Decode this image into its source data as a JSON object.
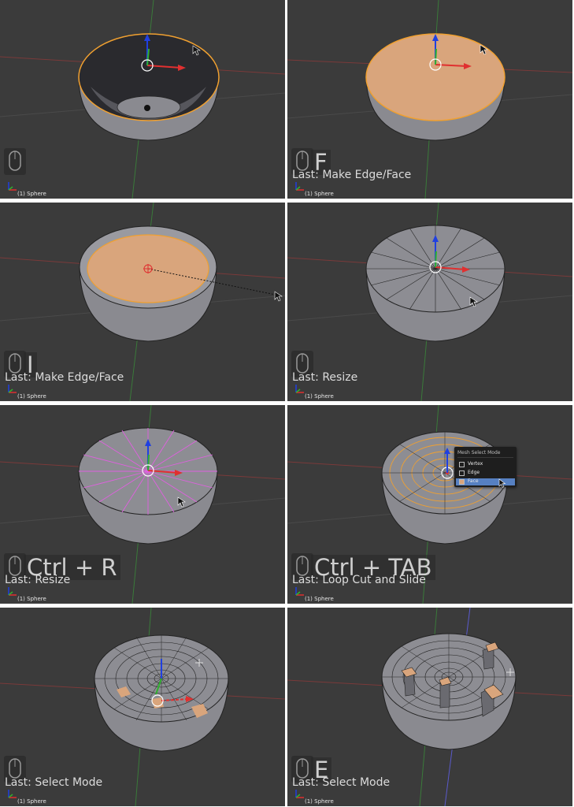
{
  "panels": [
    {
      "id": "p1",
      "key": "",
      "last_op": "",
      "object_name": "(1) Sphere"
    },
    {
      "id": "p2",
      "key": "F",
      "last_op": "Last: Make Edge/Face",
      "object_name": "(1) Sphere"
    },
    {
      "id": "p3",
      "key": "I",
      "last_op": "Last: Make Edge/Face",
      "object_name": "(1) Sphere"
    },
    {
      "id": "p4",
      "key": "",
      "last_op": "Last: Resize",
      "object_name": "(1) Sphere"
    },
    {
      "id": "p5",
      "key": "Ctrl + R",
      "last_op": "Last: Resize",
      "object_name": "(1) Sphere"
    },
    {
      "id": "p6",
      "key": "Ctrl + TAB",
      "last_op": "Last: Loop Cut and Slide",
      "object_name": "(1) Sphere"
    },
    {
      "id": "p7",
      "key": "",
      "last_op": "Last: Select Mode",
      "object_name": "(1) Sphere"
    },
    {
      "id": "p8",
      "key": "E",
      "last_op": "Last: Select Mode",
      "object_name": "(1) Sphere"
    }
  ],
  "select_mode_menu": {
    "title": "Mesh Select Mode",
    "items": [
      "Vertex",
      "Edge",
      "Face"
    ],
    "active": "Face"
  },
  "colors": {
    "viewport_bg": "#3b3b3b",
    "mesh_face": "#8d8d93",
    "selected_face": "#d9a57c",
    "selected_edge": "#f0a030",
    "loop_cut": "#e060e0",
    "axis_x": "#e03030",
    "axis_y": "#30b030",
    "axis_z": "#2040e0",
    "menu_highlight": "#5680c2"
  }
}
